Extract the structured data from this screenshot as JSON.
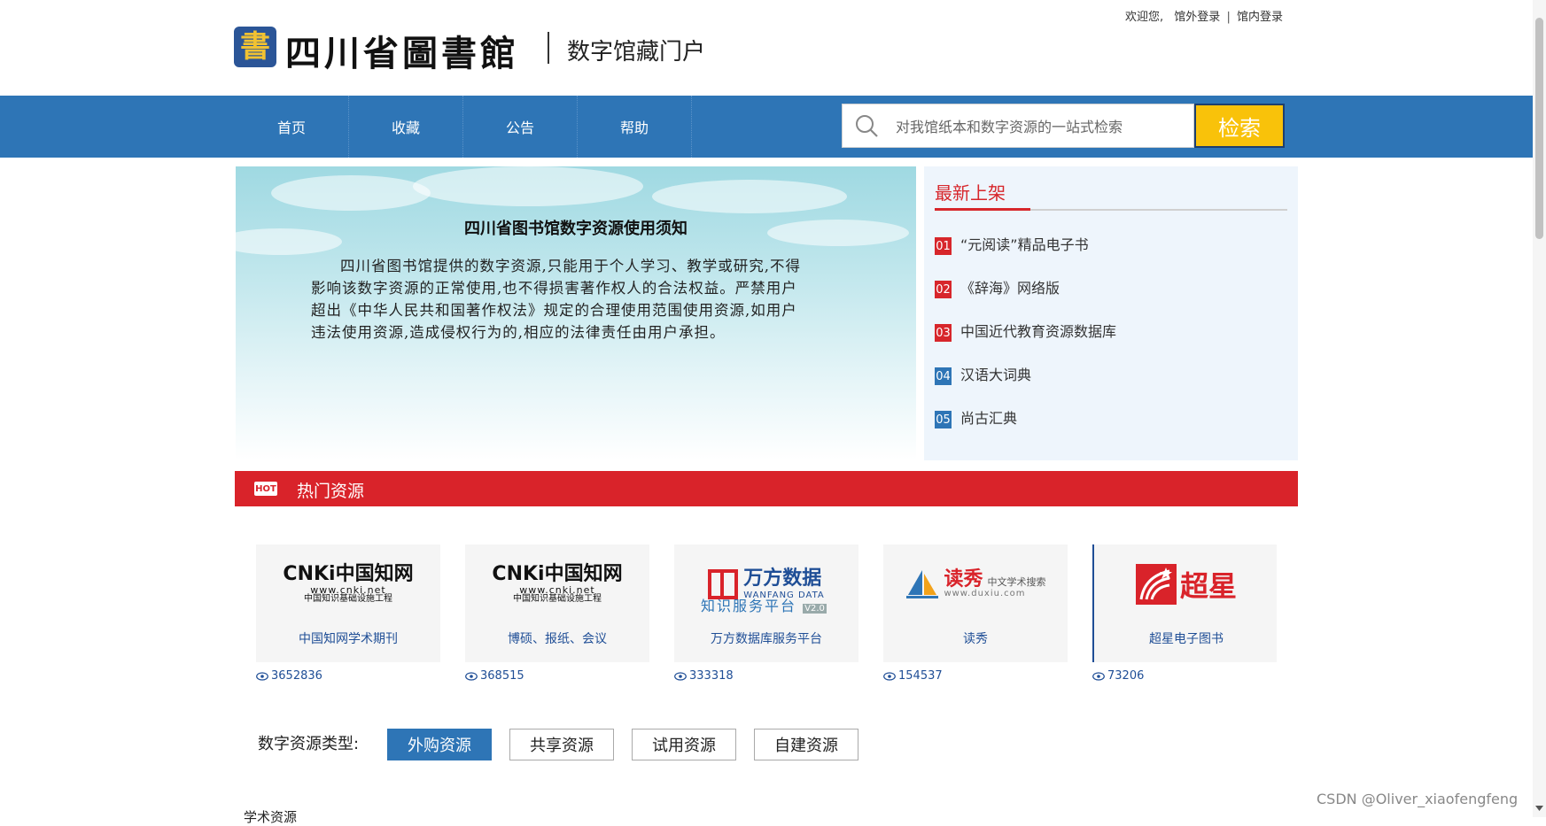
{
  "header": {
    "welcome": "欢迎您,",
    "login_external": "馆外登录",
    "separator": "|",
    "login_internal": "馆内登录",
    "logo_glyph": "書",
    "library_name": "四川省圖書館",
    "portal_name": "数字馆藏门户"
  },
  "nav": {
    "items": [
      {
        "label": "首页"
      },
      {
        "label": "收藏"
      },
      {
        "label": "公告"
      },
      {
        "label": "帮助"
      }
    ],
    "search_placeholder": "对我馆纸本和数字资源的一站式检索",
    "search_button": "检索",
    "bar_color": "#2e75b6",
    "button_color": "#f9c20a"
  },
  "notice": {
    "title": "四川省图书馆数字资源使用须知",
    "body": "四川省图书馆提供的数字资源,只能用于个人学习、教学或研究,不得影响该数字资源的正常使用,也不得损害著作权人的合法权益。严禁用户超出《中华人民共和国著作权法》规定的合理使用范围使用资源,如用户违法使用资源,造成侵权行为的,相应的法律责任由用户承担。"
  },
  "new_arrivals": {
    "title": "最新上架",
    "items": [
      {
        "num": "01",
        "title": "“元阅读”精品电子书",
        "color": "#d7262b"
      },
      {
        "num": "02",
        "title": "《辞海》网络版",
        "color": "#d7262b"
      },
      {
        "num": "03",
        "title": "中国近代教育资源数据库",
        "color": "#d7262b"
      },
      {
        "num": "04",
        "title": "汉语大词典",
        "color": "#2e75b6"
      },
      {
        "num": "05",
        "title": "尚古汇典",
        "color": "#2e75b6"
      }
    ]
  },
  "hot": {
    "badge": "HOT",
    "title": "热门资源",
    "resources": [
      {
        "label": "中国知网学术期刊",
        "views": "3652836",
        "logo_text": "CNKi中国知网",
        "logo_url": "www.cnki.net",
        "logo_sub": "中国知识基础设施工程"
      },
      {
        "label": "博硕、报纸、会议",
        "views": "368515",
        "logo_text": "CNKi中国知网",
        "logo_url": "www.cnki.net",
        "logo_sub": "中国知识基础设施工程"
      },
      {
        "label": "万方数据库服务平台",
        "views": "333318",
        "logo_text": "万方数据",
        "logo_url": "WANFANG DATA",
        "logo_sub": "知识服务平台",
        "logo_badge": "V2.0"
      },
      {
        "label": "读秀",
        "views": "154537",
        "logo_text": "读秀",
        "logo_url": "www.duxiu.com",
        "logo_sub": "中文学术搜索"
      },
      {
        "label": "超星电子图书",
        "views": "73206",
        "logo_text": "超星"
      }
    ]
  },
  "resource_types": {
    "label": "数字资源类型:",
    "options": [
      {
        "label": "外购资源",
        "active": true
      },
      {
        "label": "共享资源",
        "active": false
      },
      {
        "label": "试用资源",
        "active": false
      },
      {
        "label": "自建资源",
        "active": false
      }
    ]
  },
  "next_section": "学术资源",
  "watermark": "CSDN @Oliver_xiaofengfeng"
}
